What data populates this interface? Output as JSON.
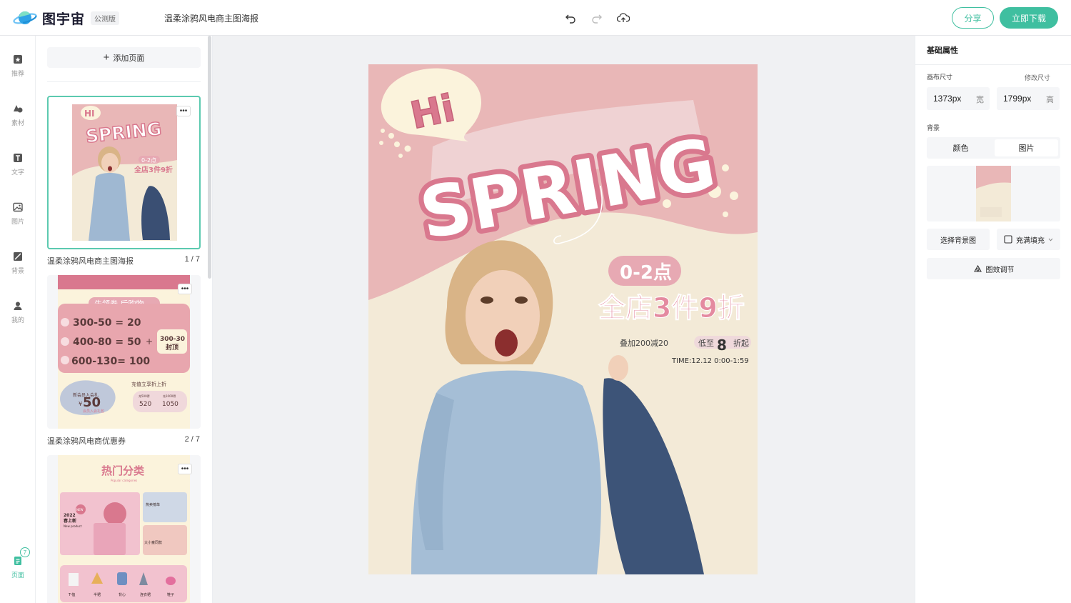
{
  "header": {
    "brand": "图宇宙",
    "beta_badge": "公测版",
    "doc_title": "温柔涂鸦风电商主图海报",
    "share_label": "分享",
    "download_label": "立即下载"
  },
  "rail": {
    "items": [
      {
        "label": "推荐",
        "icon": "template-icon"
      },
      {
        "label": "素材",
        "icon": "shapes-icon"
      },
      {
        "label": "文字",
        "icon": "text-icon"
      },
      {
        "label": "图片",
        "icon": "image-icon"
      },
      {
        "label": "背景",
        "icon": "background-icon"
      },
      {
        "label": "我的",
        "icon": "user-icon"
      }
    ],
    "pages_label": "页面",
    "pages_count": "7"
  },
  "pages_panel": {
    "add_page_label": "添加页面",
    "more_glyph": "•••",
    "pages": [
      {
        "title": "温柔涂鸦风电商主图海报",
        "number": "1 / 7"
      },
      {
        "title": "温柔涂鸦风电商优惠券",
        "number": "2 / 7"
      }
    ],
    "thumb1": {
      "hi": "HI",
      "spring": "SPRING",
      "time": "0-2点",
      "promo": "全店3件9折"
    },
    "thumb2": {
      "banner": "先领券 后购物",
      "rows": [
        "300-50 = 20",
        "400-80 = 50",
        "600-130= 100"
      ],
      "plus": "+",
      "cap1": "300-30",
      "cap2": "封顶",
      "vip_title": "新会员入会礼",
      "vip_yen": "¥",
      "vip_amount": "50",
      "vip_sub": "会员入会礼包",
      "recharge_title": "充值立享折上折",
      "recharge_a": "520",
      "recharge_b": "1050",
      "recharge_a_lbl": "充500得",
      "recharge_b_lbl": "充1000得"
    },
    "thumb3": {
      "title": "热门分类",
      "subtitle": "Popular categories",
      "year": "2022",
      "new_label": "春上新",
      "new_en": "New product",
      "badge_new": "NEW",
      "cat1": "热卖榜单",
      "cat2": "大小童同款",
      "items": [
        "T-恤",
        "半裙",
        "背心",
        "连衣裙",
        "鞋子"
      ]
    }
  },
  "poster": {
    "hi": "Hi",
    "spring": "SPRING",
    "time_badge": "0-2点",
    "promo": "全店3件9折",
    "stack": "叠加200减20",
    "low_prefix": "低至",
    "low_num": "8",
    "low_suffix": "折起",
    "time_detail": "TIME:12.12 0:00-1:59"
  },
  "props": {
    "title": "基础属性",
    "canvas_size_label": "画布尺寸",
    "edit_size_label": "修改尺寸",
    "width_value": "1373px",
    "width_unit": "宽",
    "height_value": "1799px",
    "height_unit": "高",
    "background_label": "背景",
    "tab_color": "颜色",
    "tab_image": "图片",
    "choose_bg": "选择背景图",
    "fill_mode": "充满填充",
    "effects": "图效调节"
  },
  "colors": {
    "accent": "#3fbfa0",
    "poster_pink": "#e9b7b7",
    "poster_cream": "#f3ead7",
    "brand_pink": "#d9788e"
  }
}
